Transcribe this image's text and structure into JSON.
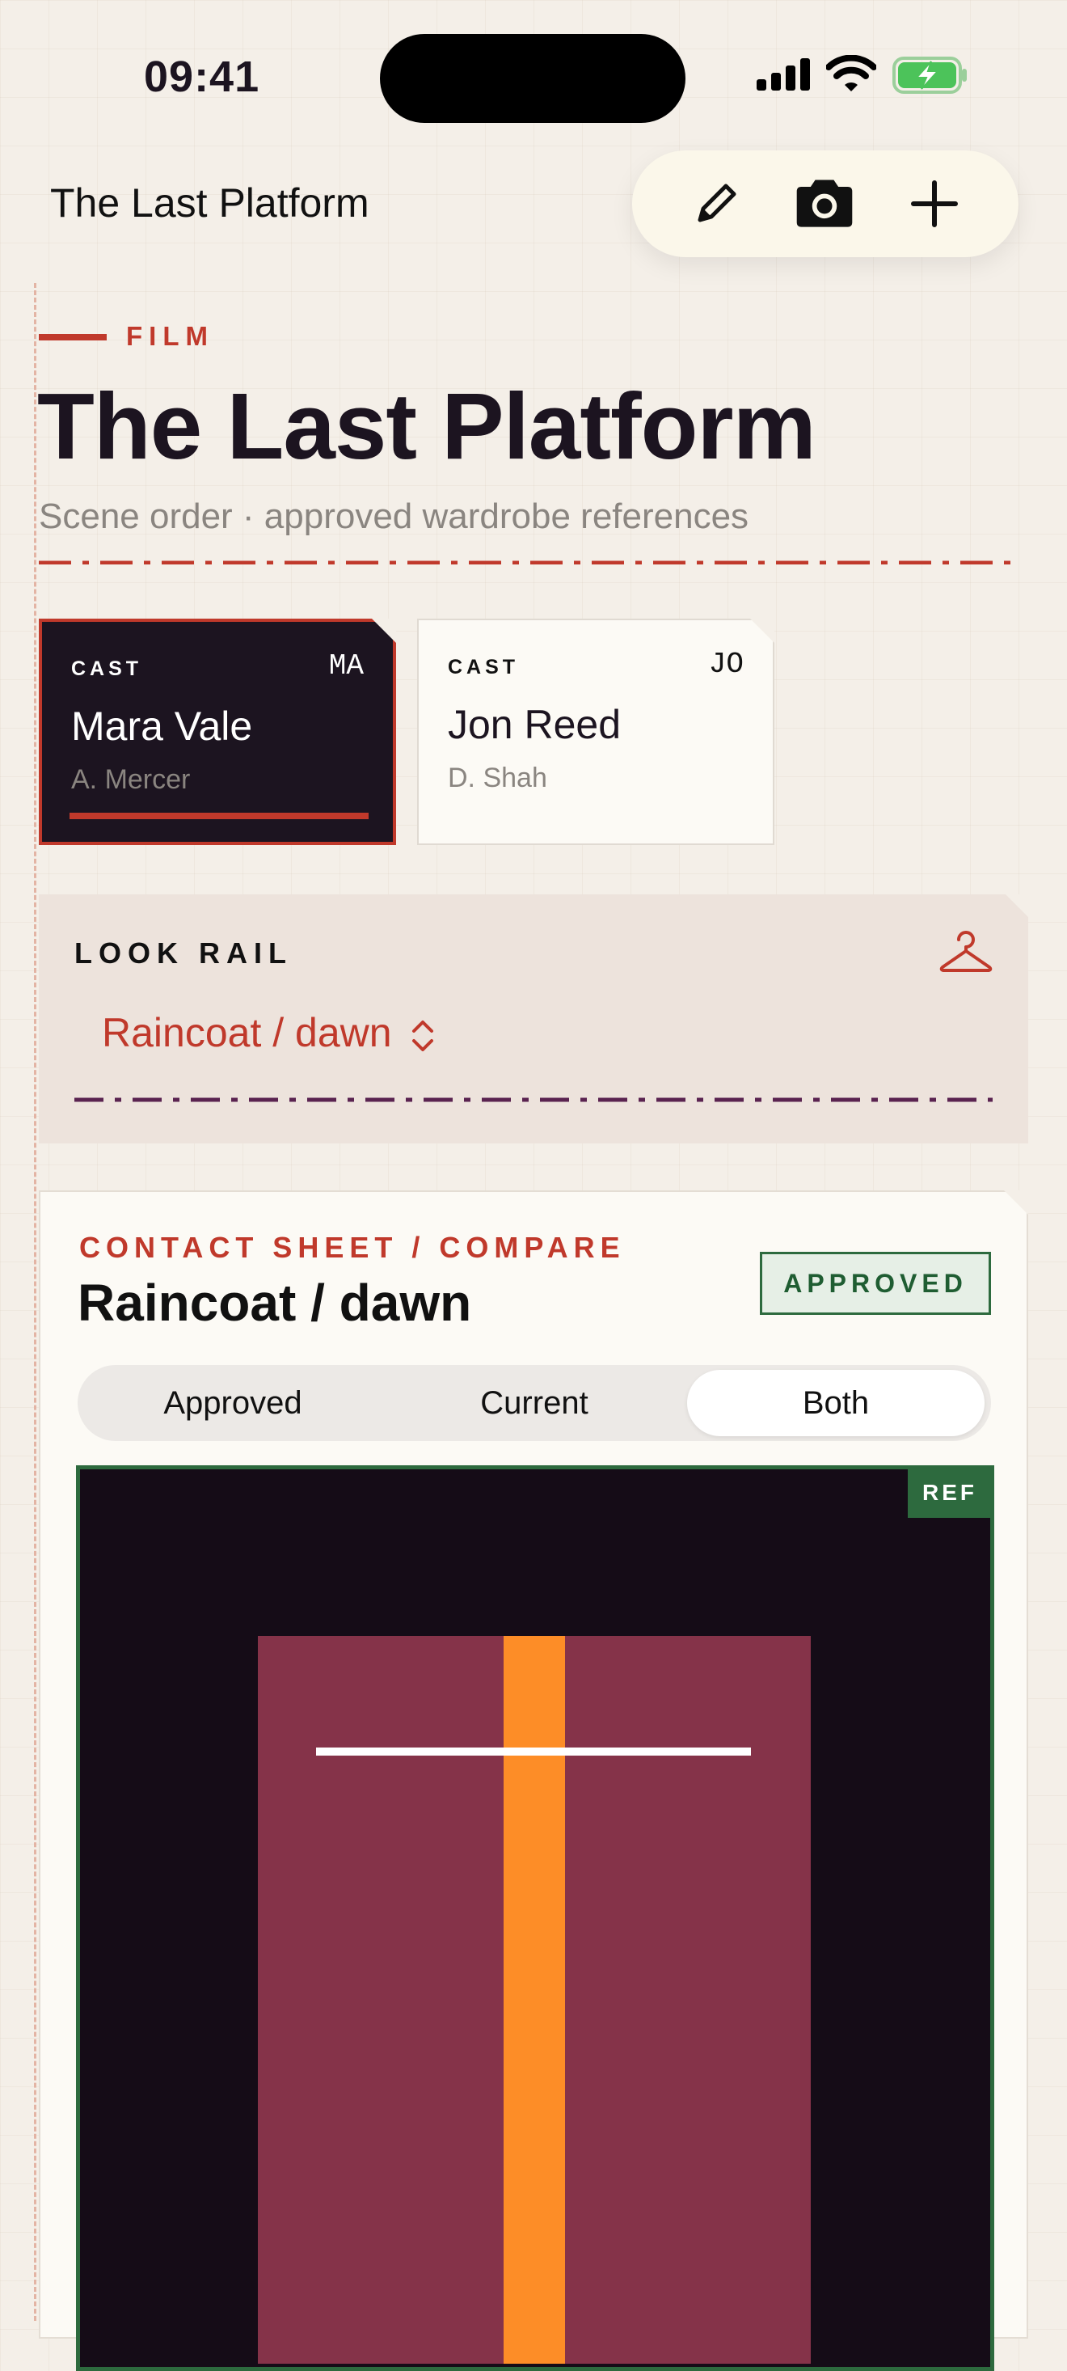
{
  "status_bar": {
    "time": "09:41"
  },
  "nav": {
    "title": "The Last Platform",
    "tools": [
      {
        "icon": "pencil-icon"
      },
      {
        "icon": "camera-icon"
      },
      {
        "icon": "plus-icon"
      }
    ]
  },
  "header": {
    "kicker": "FILM",
    "title": "The Last Platform",
    "subtitle": "Scene order · approved wardrobe references"
  },
  "cast": [
    {
      "label": "CAST",
      "initials": "MA",
      "name": "Mara Vale",
      "actor": "A. Mercer",
      "selected": true
    },
    {
      "label": "CAST",
      "initials": "JO",
      "name": "Jon Reed",
      "actor": "D. Shah",
      "selected": false
    }
  ],
  "look_rail": {
    "label": "LOOK RAIL",
    "selected_look": "Raincoat / dawn",
    "icon": "hanger-icon"
  },
  "compare": {
    "kicker": "CONTACT SHEET / COMPARE",
    "title": "Raincoat / dawn",
    "status_badge": "APPROVED",
    "segments": [
      "Approved",
      "Current",
      "Both"
    ],
    "selected_segment": "Both",
    "ref_badge": "REF"
  },
  "colors": {
    "accent": "#c0392b",
    "ink": "#1c1420",
    "approved_green": "#2d6a3e",
    "coat": "#853349",
    "coat_stripe": "#fd8d27",
    "rail_rule": "#5a2350"
  }
}
